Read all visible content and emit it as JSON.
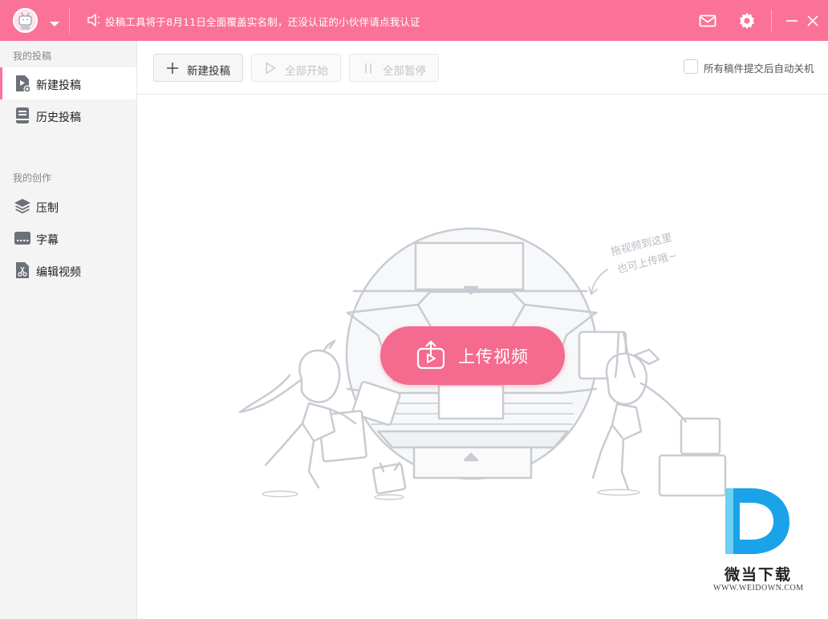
{
  "titlebar": {
    "notice": "投稿工具将于8月11日全面覆盖实名制，还没认证的小伙伴请点我认证",
    "icons": [
      "avatar",
      "dropdown-icon",
      "speaker-icon",
      "mail-icon",
      "gear-icon",
      "minimize-icon",
      "close-icon"
    ]
  },
  "sidebar": {
    "section1_title": "我的投稿",
    "section2_title": "我的创作",
    "items": [
      {
        "label": "新建投稿",
        "icon": "new-upload-icon",
        "active": true
      },
      {
        "label": "历史投稿",
        "icon": "history-icon",
        "active": false
      },
      {
        "label": "压制",
        "icon": "layers-icon",
        "active": false
      },
      {
        "label": "字幕",
        "icon": "subtitle-icon",
        "active": false
      },
      {
        "label": "编辑视频",
        "icon": "edit-video-icon",
        "active": false
      }
    ]
  },
  "toolbar": {
    "new_label": "新建投稿",
    "start_all_label": "全部开始",
    "pause_all_label": "全部暂停",
    "shutdown_label": "所有稿件提交后自动关机",
    "shutdown_checked": false
  },
  "main": {
    "upload_label": "上传视频",
    "hint_line1": "拖视频到这里",
    "hint_line2": "也可上传哦~"
  },
  "watermark": {
    "name": "微当下载",
    "url": "WWW.WEIDOWN.COM"
  },
  "colors": {
    "accent": "#fb7299",
    "button": "#f46b8f",
    "sidebar_bg": "#f4f4f4",
    "illustration_line": "#c8ccd2"
  }
}
